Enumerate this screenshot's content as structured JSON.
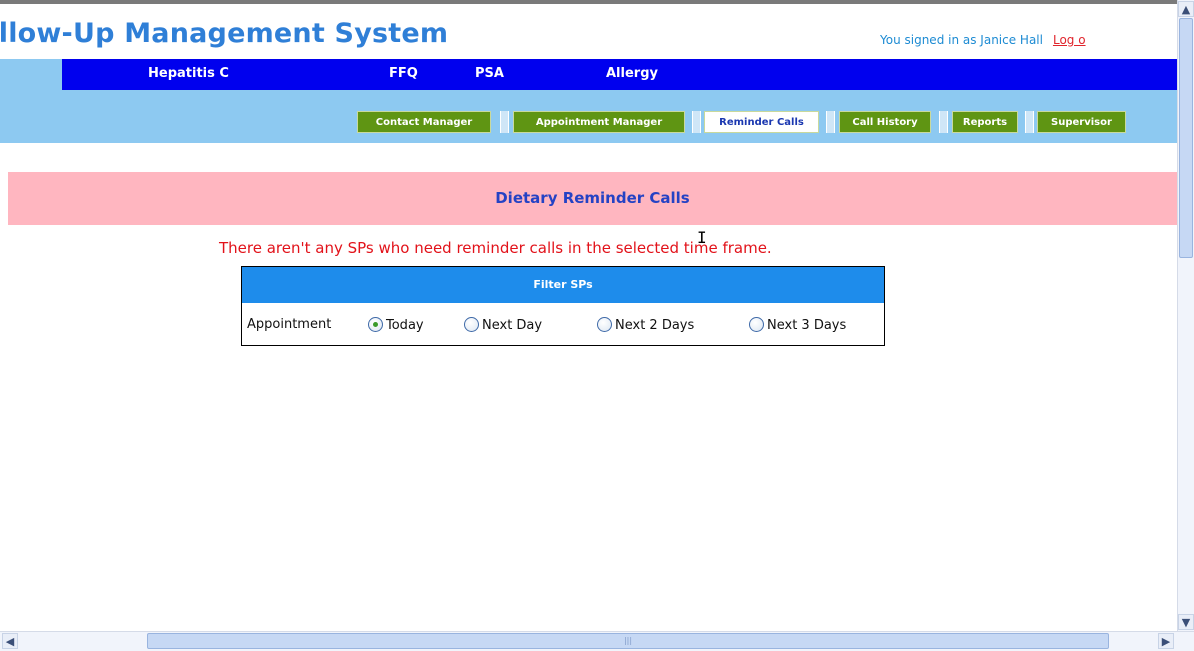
{
  "app": {
    "title": "ollow-Up Management System",
    "user_text": "You signed in as Janice Hall",
    "logout_label": "Log o"
  },
  "nav": {
    "items": [
      {
        "label": "Hepatitis C"
      },
      {
        "label": "FFQ"
      },
      {
        "label": "PSA"
      },
      {
        "label": "Allergy"
      }
    ]
  },
  "subnav": {
    "tabs": [
      {
        "label": "Contact Manager",
        "active": false
      },
      {
        "label": "Appointment Manager",
        "active": false
      },
      {
        "label": "Reminder Calls",
        "active": true
      },
      {
        "label": "Call History",
        "active": false
      },
      {
        "label": "Reports",
        "active": false
      },
      {
        "label": "Supervisor",
        "active": false
      }
    ]
  },
  "page": {
    "heading": "Dietary Reminder Calls",
    "notice": "There aren't any SPs who need reminder calls in the selected time frame."
  },
  "filter": {
    "header": "Filter SPs",
    "label": "Appointment",
    "options": [
      {
        "label": "Today",
        "checked": true
      },
      {
        "label": "Next Day",
        "checked": false
      },
      {
        "label": "Next 2 Days",
        "checked": false
      },
      {
        "label": "Next 3 Days",
        "checked": false
      }
    ]
  },
  "colors": {
    "title_blue": "#2f7fd7",
    "nav_blue": "#0000ee",
    "nav_light": "#8dc9f1",
    "tab_green": "#5f9513",
    "banner_pink": "#ffb6c0",
    "notice_red": "#e2121a",
    "filter_header": "#1e8ceb"
  }
}
